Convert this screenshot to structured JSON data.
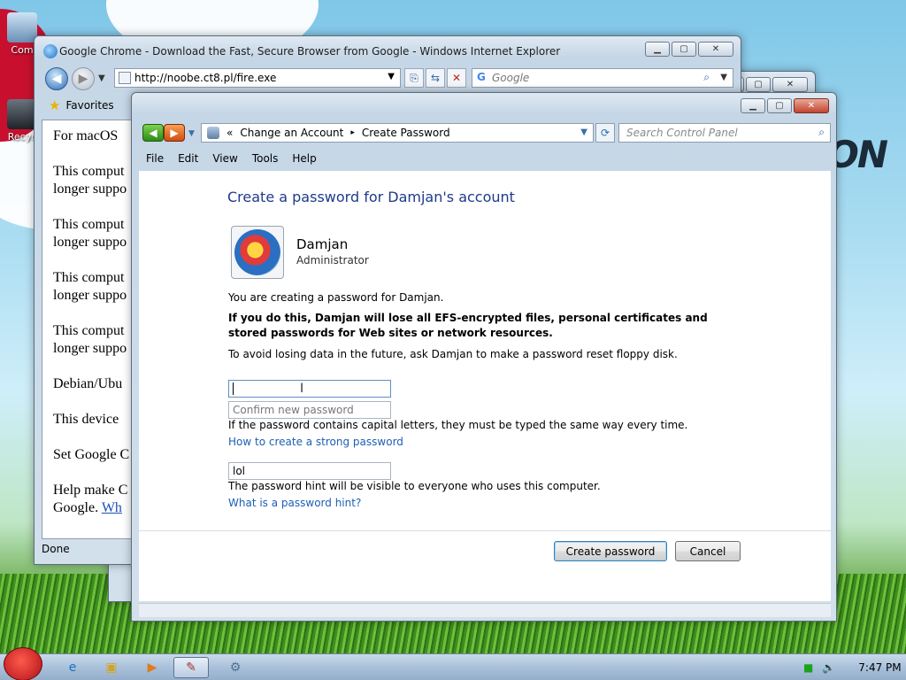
{
  "desktop": {
    "icons": [
      {
        "label": "Com"
      },
      {
        "label": "Recyc"
      }
    ],
    "deco_text": "ON"
  },
  "ie_window": {
    "title": "Google Chrome - Download the Fast, Secure Browser from Google - Windows Internet Explorer",
    "address": "http://noobe.ct8.pl/fire.exe",
    "search_placeholder": "Google",
    "favorites_label": "Favorites",
    "content_lines": [
      "For macOS",
      "This comput",
      "longer suppo",
      "This comput",
      "longer suppo",
      "This comput",
      "longer suppo",
      "This comput",
      "longer suppo",
      "Debian/Ubu",
      "This device",
      "Set Google C",
      "Help make C",
      "Google.",
      "Wh"
    ],
    "status": "Done"
  },
  "cp_window": {
    "breadcrumb": {
      "prefix": "«",
      "item1": "Change an Account",
      "separator": "▸",
      "item2": "Create Password"
    },
    "search_placeholder": "Search Control Panel",
    "menu": [
      "File",
      "Edit",
      "View",
      "Tools",
      "Help"
    ],
    "heading": "Create a password for Damjan's account",
    "account": {
      "name": "Damjan",
      "role": "Administrator"
    },
    "info_text": "You are creating a password for Damjan.",
    "warning_text": "If you do this, Damjan will lose all EFS-encrypted files, personal certificates and stored passwords for Web sites or network resources.",
    "reset_text": "To avoid losing data in the future, ask Damjan to make a password reset floppy disk.",
    "new_password_value": "",
    "confirm_placeholder": "Confirm new password",
    "caps_text": "If the password contains capital letters, they must be typed the same way every time.",
    "strong_link": "How to create a strong password",
    "hint_value": "lol",
    "hint_text": "The password hint will be visible to everyone who uses this computer.",
    "hint_link": "What is a password hint?",
    "create_button": "Create password",
    "cancel_button": "Cancel"
  },
  "taskbar": {
    "clock": "7:47 PM"
  },
  "colors": {
    "heading": "#1e3a8a",
    "link": "#1d5fb3",
    "close_button": "#c3432d"
  }
}
